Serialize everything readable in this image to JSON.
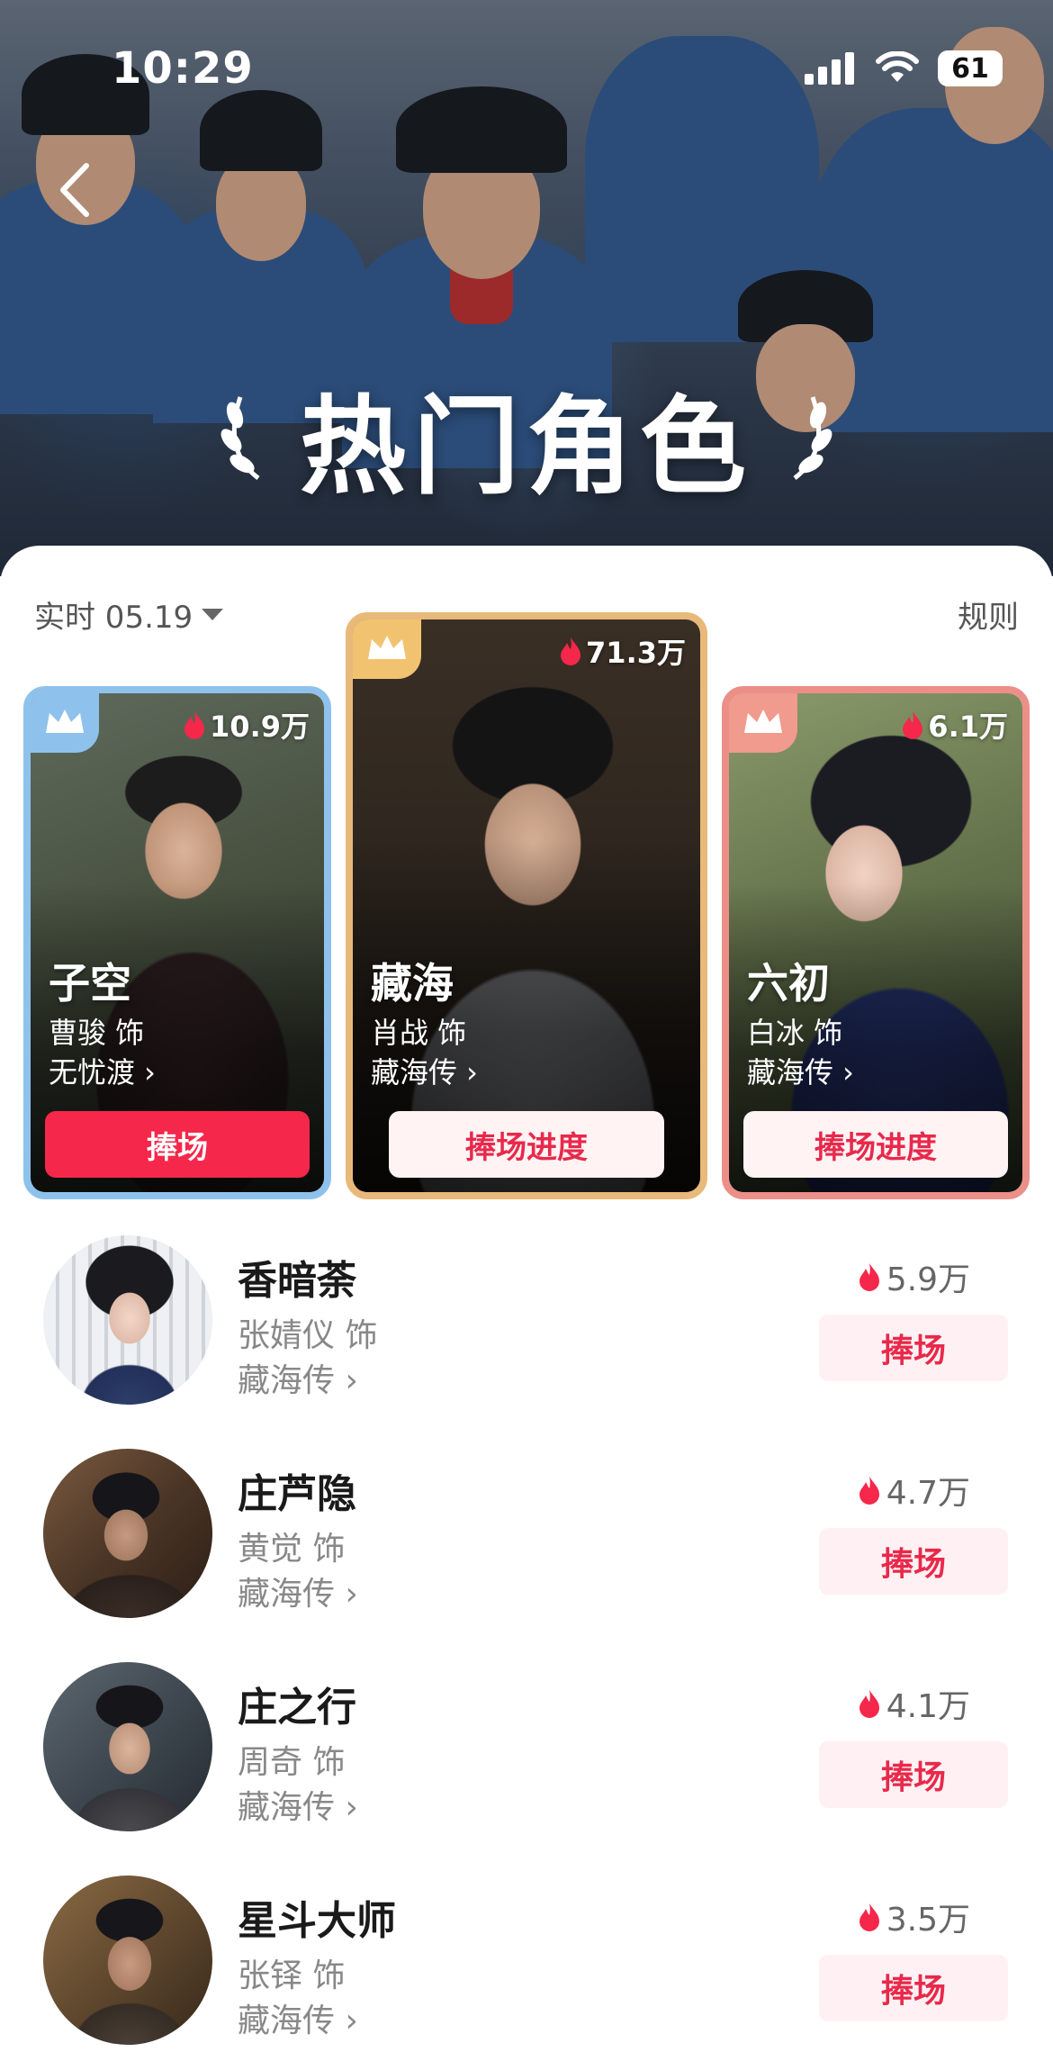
{
  "status_bar": {
    "time": "10:29",
    "battery": "61"
  },
  "header": {
    "title": "热门角色"
  },
  "filter": {
    "label": "实时 05.19",
    "rules_label": "规则"
  },
  "colors": {
    "accent": "#f5274a",
    "light_button_bg": "#fff3f4",
    "gold_border": "#e9b97a",
    "blue_border": "#8ec2ec",
    "pink_border": "#ec8f89"
  },
  "top3": [
    {
      "rank": 2,
      "name": "子空",
      "actor": "曹骏 饰",
      "show": "无忧渡 ›",
      "heat": "10.9万",
      "button": "捧场",
      "crown": "blue-crown-icon"
    },
    {
      "rank": 1,
      "name": "藏海",
      "actor": "肖战 饰",
      "show": "藏海传 ›",
      "heat": "71.3万",
      "button": "捧场进度",
      "crown": "gold-crown-icon"
    },
    {
      "rank": 3,
      "name": "六初",
      "actor": "白冰 饰",
      "show": "藏海传 ›",
      "heat": "6.1万",
      "button": "捧场进度",
      "crown": "bronze-crown-icon"
    }
  ],
  "list": [
    {
      "name": "香暗荼",
      "actor": "张婧仪 饰",
      "show": "藏海传 ›",
      "heat": "5.9万",
      "button": "捧场"
    },
    {
      "name": "庄芦隐",
      "actor": "黄觉 饰",
      "show": "藏海传 ›",
      "heat": "4.7万",
      "button": "捧场"
    },
    {
      "name": "庄之行",
      "actor": "周奇 饰",
      "show": "藏海传 ›",
      "heat": "4.1万",
      "button": "捧场"
    },
    {
      "name": "星斗大师",
      "actor": "张铎 饰",
      "show": "藏海传 ›",
      "heat": "3.5万",
      "button": "捧场"
    }
  ]
}
